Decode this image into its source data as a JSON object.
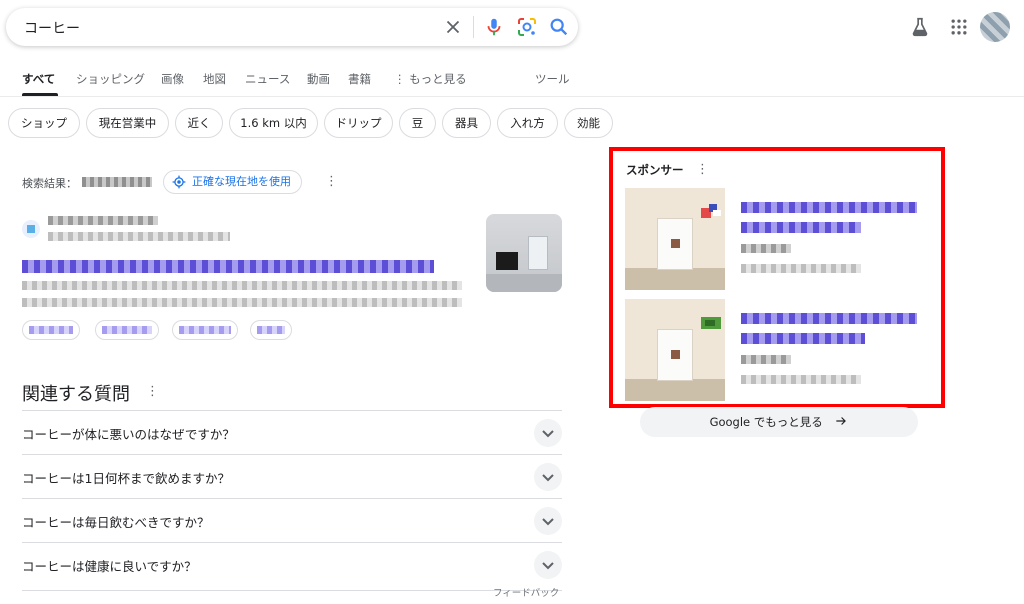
{
  "search": {
    "query": "コーヒー"
  },
  "tabs": [
    {
      "label": "すべて"
    },
    {
      "label": "ショッピング"
    },
    {
      "label": "画像"
    },
    {
      "label": "地図"
    },
    {
      "label": "ニュース"
    },
    {
      "label": "動画"
    },
    {
      "label": "書籍"
    },
    {
      "label": "⋮ もっと見る"
    },
    {
      "label": "ツール"
    }
  ],
  "chips": [
    {
      "label": "ショップ"
    },
    {
      "label": "現在営業中"
    },
    {
      "label": "近く"
    },
    {
      "label": "1.6 km 以内"
    },
    {
      "label": "ドリップ"
    },
    {
      "label": "豆"
    },
    {
      "label": "器具"
    },
    {
      "label": "入れ方"
    },
    {
      "label": "効能"
    }
  ],
  "location": {
    "prefix": "検索結果：",
    "precise_label": "正確な現在地を使用"
  },
  "paa": {
    "title": "関連する質問",
    "questions": [
      {
        "text": "コーヒーが体に悪いのはなぜですか？"
      },
      {
        "text": "コーヒーは1日何杯まで飲めますか？"
      },
      {
        "text": "コーヒーは毎日飲むべきですか？"
      },
      {
        "text": "コーヒーは健康に良いですか？"
      }
    ],
    "feedback": "フィードバック"
  },
  "sponsored": {
    "title": "スポンサー",
    "more_label": "Google でもっと見る"
  },
  "colors": {
    "accent": "#1a73e8",
    "highlight_border": "#ff0000"
  }
}
